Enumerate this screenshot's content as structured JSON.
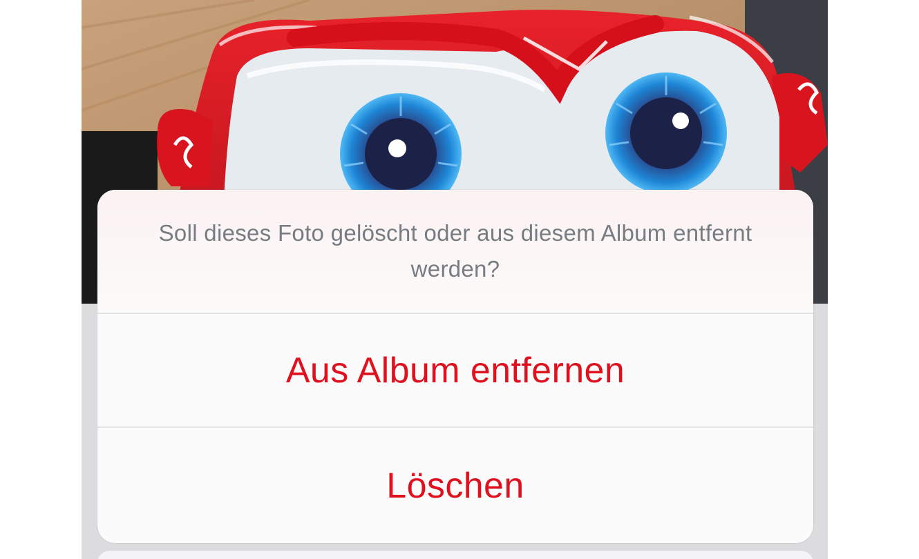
{
  "alert": {
    "message": "Soll dieses Foto gelöscht oder aus diesem Album entfernt werden?",
    "actions": [
      {
        "label": "Aus Album entfernen"
      },
      {
        "label": "Löschen"
      }
    ]
  },
  "colors": {
    "destructive": "#e0111f",
    "message_text": "#777c82",
    "sheet_background": "#fcfcfd"
  }
}
